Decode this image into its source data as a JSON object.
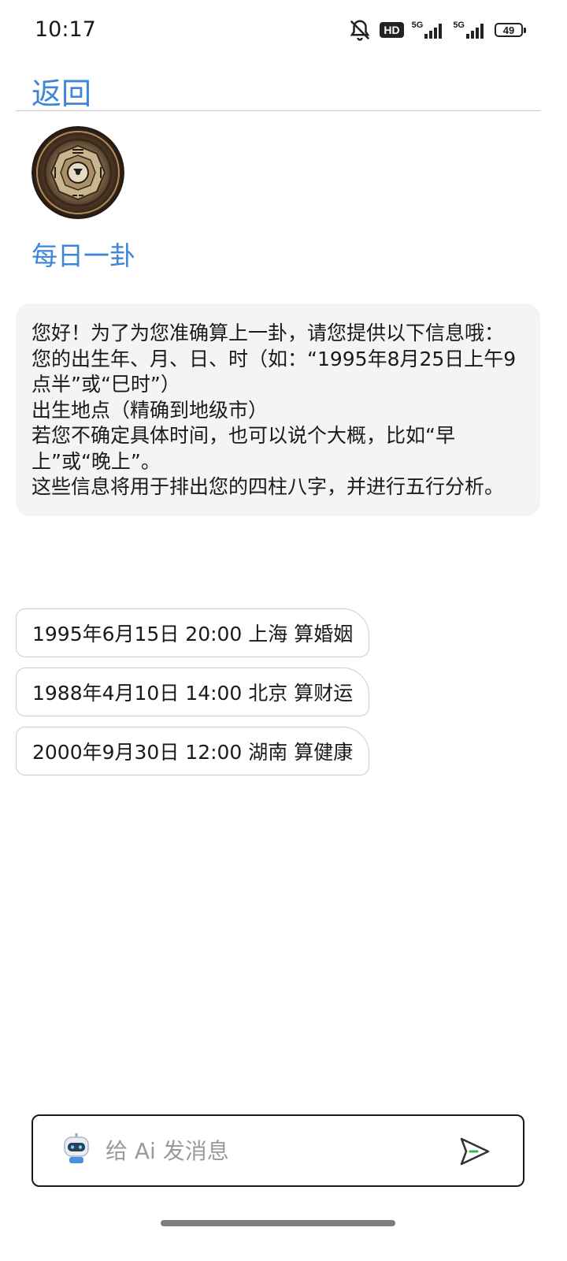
{
  "status_bar": {
    "time": "10:17",
    "hd_label": "HD",
    "network_1": "5G",
    "network_2": "5G",
    "battery_level": "49"
  },
  "header": {
    "back_label": "返回"
  },
  "bot": {
    "name": "每日一卦"
  },
  "chat": {
    "greeting_lines": [
      "您好！为了为您准确算上一卦，请您提供以下信息哦：",
      "您的出生年、月、日、时（如：“1995年8月25日上午9点半”或“巳时”）",
      "出生地点（精确到地级市）",
      "若您不确定具体时间，也可以说个大概，比如“早上”或“晚上”。",
      "这些信息将用于排出您的四柱八字，并进行五行分析。"
    ]
  },
  "suggestions": [
    "1995年6月15日 20:00 上海 算婚姻",
    "1988年4月10日 14:00 北京 算财运",
    "2000年9月30日 12:00 湖南 算健康"
  ],
  "input": {
    "placeholder": "给 Ai 发消息",
    "value": ""
  },
  "colors": {
    "accent": "#3d86d8",
    "bubble_bg": "#f4f4f5",
    "border": "#cccccc",
    "send_icon_accent": "#2fb84f"
  },
  "icons": {
    "mute": "bell-off-icon",
    "signal": "signal-bars-icon",
    "battery": "battery-icon",
    "robot": "robot-icon",
    "send": "send-icon"
  }
}
